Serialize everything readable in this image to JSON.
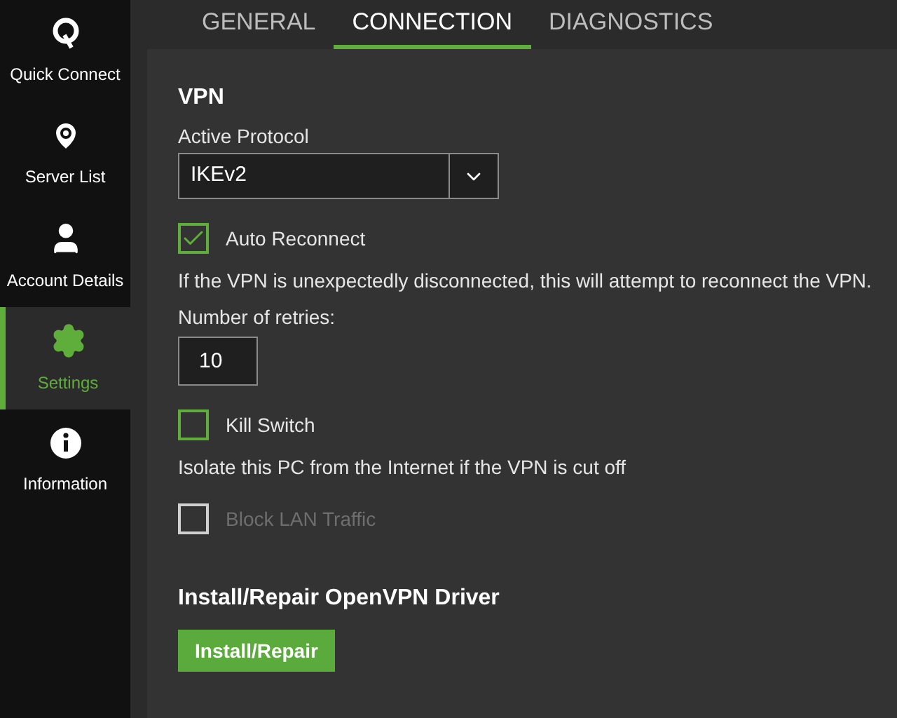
{
  "sidebar": {
    "items": [
      {
        "label": "Quick Connect",
        "selected": false
      },
      {
        "label": "Server List",
        "selected": false
      },
      {
        "label": "Account Details",
        "selected": false
      },
      {
        "label": "Settings",
        "selected": true
      },
      {
        "label": "Information",
        "selected": false
      }
    ]
  },
  "tabs": [
    {
      "label": "GENERAL",
      "selected": false
    },
    {
      "label": "CONNECTION",
      "selected": true
    },
    {
      "label": "DIAGNOSTICS",
      "selected": false
    }
  ],
  "sections": [
    {
      "title": "VPN",
      "rows": [
        {
          "kind": "label",
          "text": "Active Protocol"
        },
        {
          "kind": "dropdown",
          "value": "IKEv2"
        },
        {
          "kind": "checkbox",
          "label": "Auto Reconnect",
          "checked": true,
          "disabled": false
        },
        {
          "kind": "description",
          "text": "If the VPN is unexpectedly disconnected, this will attempt to reconnect the VPN."
        },
        {
          "kind": "label",
          "text": "Number of retries:"
        },
        {
          "kind": "number",
          "value": "10"
        },
        {
          "kind": "checkbox",
          "label": "Kill Switch",
          "checked": false,
          "disabled": false
        },
        {
          "kind": "description",
          "text": "Isolate this PC from the Internet if the VPN is cut off"
        },
        {
          "kind": "checkbox",
          "label": "Block LAN Traffic",
          "checked": false,
          "disabled": true
        }
      ]
    },
    {
      "title": "Install/Repair OpenVPN Driver",
      "rows": [
        {
          "kind": "button",
          "label": "Install/Repair"
        }
      ]
    }
  ]
}
